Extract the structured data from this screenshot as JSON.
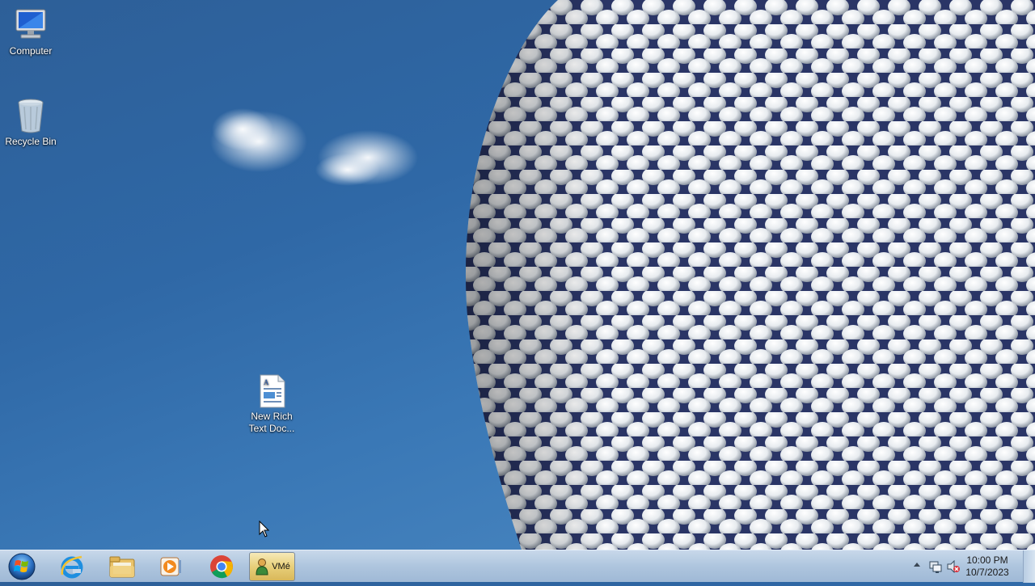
{
  "desktop": {
    "icons": [
      {
        "label": "Computer",
        "icon": "computer-icon"
      },
      {
        "label": "Recycle Bin",
        "icon": "recycle-bin-icon"
      },
      {
        "label": "New Rich Text Doc...",
        "label_line1": "New Rich",
        "label_line2": "Text Doc...",
        "icon": "rich-text-document-icon"
      }
    ]
  },
  "taskbar": {
    "start": {
      "icon": "windows-start-orb-icon"
    },
    "pinned": [
      {
        "name": "Internet Explorer",
        "icon": "internet-explorer-icon"
      },
      {
        "name": "Windows Explorer",
        "icon": "file-explorer-icon"
      },
      {
        "name": "Windows Media Player",
        "icon": "media-player-icon"
      },
      {
        "name": "Google Chrome",
        "icon": "chrome-icon"
      }
    ],
    "active_app": {
      "label": "VMé",
      "icon": "vm-app-icon"
    },
    "tray": {
      "time": "10:00 PM",
      "date": "10/7/2023",
      "icons": [
        "show-hidden-icons-arrow",
        "network-icon",
        "volume-muted-icon"
      ]
    }
  },
  "colors": {
    "sky": "#2f68a6",
    "taskbar": "#b3c9e0",
    "active_button": "#e8cf7a"
  }
}
